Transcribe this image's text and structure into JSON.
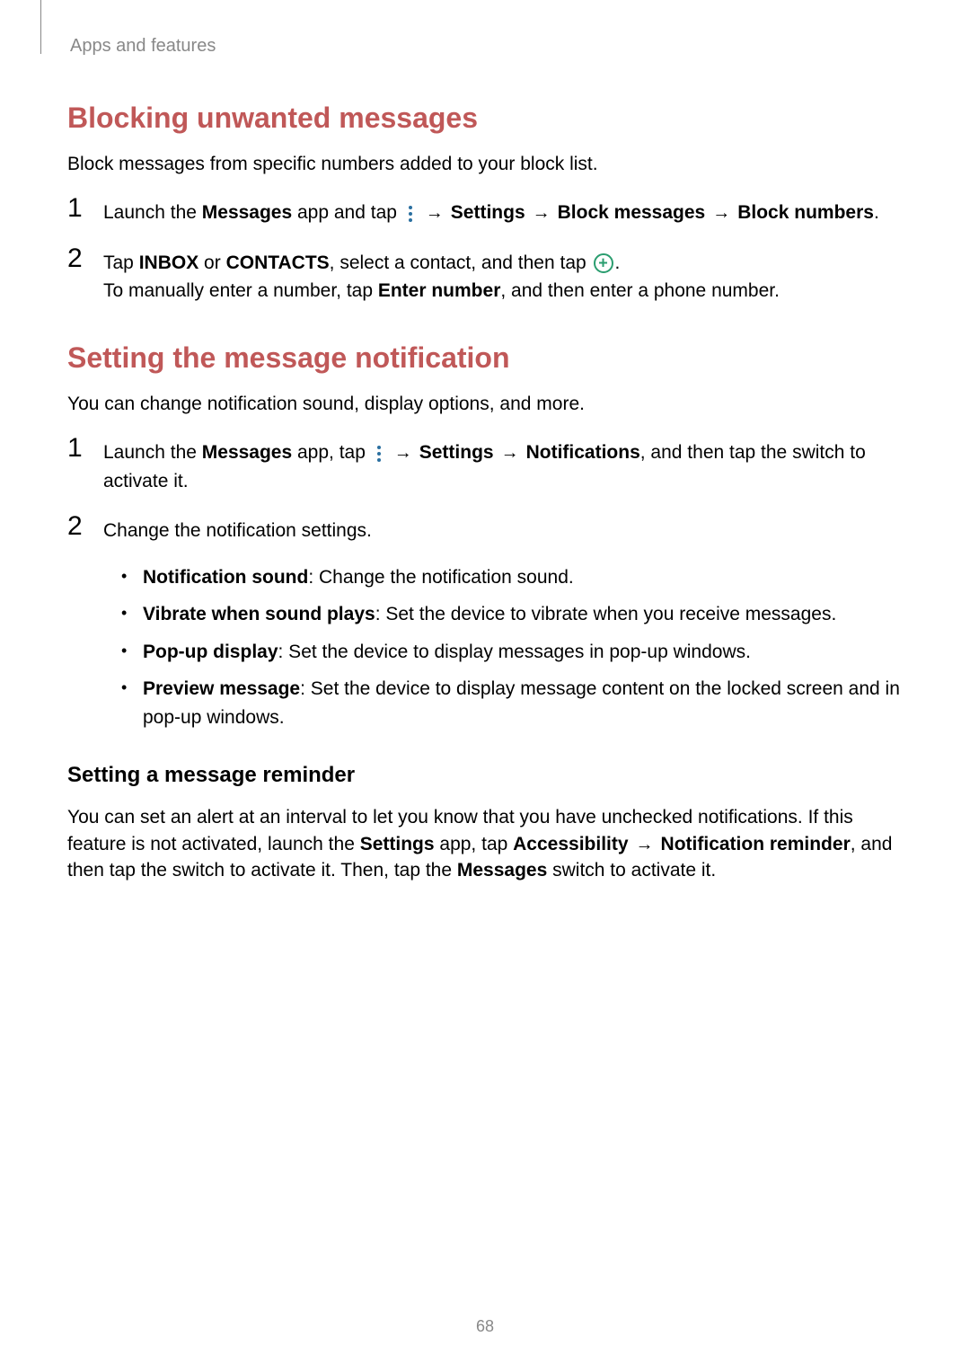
{
  "header": {
    "breadcrumb": "Apps and features"
  },
  "section1": {
    "heading": "Blocking unwanted messages",
    "intro": "Block messages from specific numbers added to your block list.",
    "step1": {
      "num": "1",
      "pre": "Launch the ",
      "app": "Messages",
      "mid1": " app and tap ",
      "arrow1": " → ",
      "opt1": "Settings",
      "arrow2": " → ",
      "opt2": "Block messages",
      "arrow3": " → ",
      "opt3": "Block numbers",
      "end": "."
    },
    "step2": {
      "num": "2",
      "pre": "Tap ",
      "opt1": "INBOX",
      "or": " or ",
      "opt2": "CONTACTS",
      "mid": ", select a contact, and then tap ",
      "end": ".",
      "line2pre": "To manually enter a number, tap ",
      "line2bold": "Enter number",
      "line2end": ", and then enter a phone number."
    }
  },
  "section2": {
    "heading": "Setting the message notification",
    "intro": "You can change notification sound, display options, and more.",
    "step1": {
      "num": "1",
      "pre": "Launch the ",
      "app": "Messages",
      "mid1": " app, tap ",
      "arrow1": " → ",
      "opt1": "Settings",
      "arrow2": " → ",
      "opt2": "Notifications",
      "end": ", and then tap the switch to activate it."
    },
    "step2": {
      "num": "2",
      "text": "Change the notification settings.",
      "bullets": [
        {
          "label": "Notification sound",
          "desc": ": Change the notification sound."
        },
        {
          "label": "Vibrate when sound plays",
          "desc": ": Set the device to vibrate when you receive messages."
        },
        {
          "label": "Pop-up display",
          "desc": ": Set the device to display messages in pop-up windows."
        },
        {
          "label": "Preview message",
          "desc": ": Set the device to display message content on the locked screen and in pop-up windows."
        }
      ]
    },
    "subsection": {
      "heading": "Setting a message reminder",
      "p1a": "You can set an alert at an interval to let you know that you have unchecked notifications. If this feature is not activated, launch the ",
      "p1b": "Settings",
      "p1c": " app, tap ",
      "p1d": "Accessibility",
      "arrow": " → ",
      "p1e": "Notification reminder",
      "p1f": ", and then tap the switch to activate it. Then, tap the ",
      "p1g": "Messages",
      "p1h": " switch to activate it."
    }
  },
  "pageNumber": "68"
}
